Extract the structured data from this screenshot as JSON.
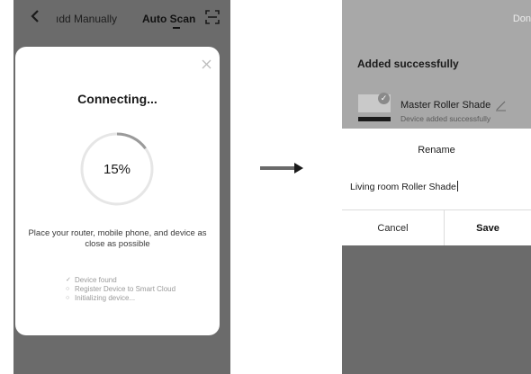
{
  "left_screen": {
    "header": {
      "tab_manual": "ıdd Manually",
      "tab_auto": "Auto Scan",
      "back_icon": "chevron-left-icon",
      "scan_icon": "scan-frame-icon"
    },
    "dialog": {
      "title": "Connecting...",
      "progress_text": "15%",
      "progress": 0.15,
      "hint": "Place your router, mobile phone, and device as close as possible",
      "steps": [
        {
          "mark": "✓",
          "label": "Device found"
        },
        {
          "mark": "○",
          "label": "Register Device to Smart Cloud"
        },
        {
          "mark": "○",
          "label": "Initializing device..."
        }
      ],
      "close_icon": "close-icon"
    }
  },
  "right_screen": {
    "header": {
      "done": "Don"
    },
    "added_title": "Added successfully",
    "device": {
      "name": "Master Roller Shade",
      "status": "Device added successfully",
      "check_icon": "check-circle-icon",
      "edit_icon": "pencil-icon"
    },
    "rename_dialog": {
      "title": "Rename",
      "input_value": "Living room Roller Shade",
      "cancel": "Cancel",
      "save": "Save"
    }
  },
  "arrow_icon": "arrow-right-icon"
}
